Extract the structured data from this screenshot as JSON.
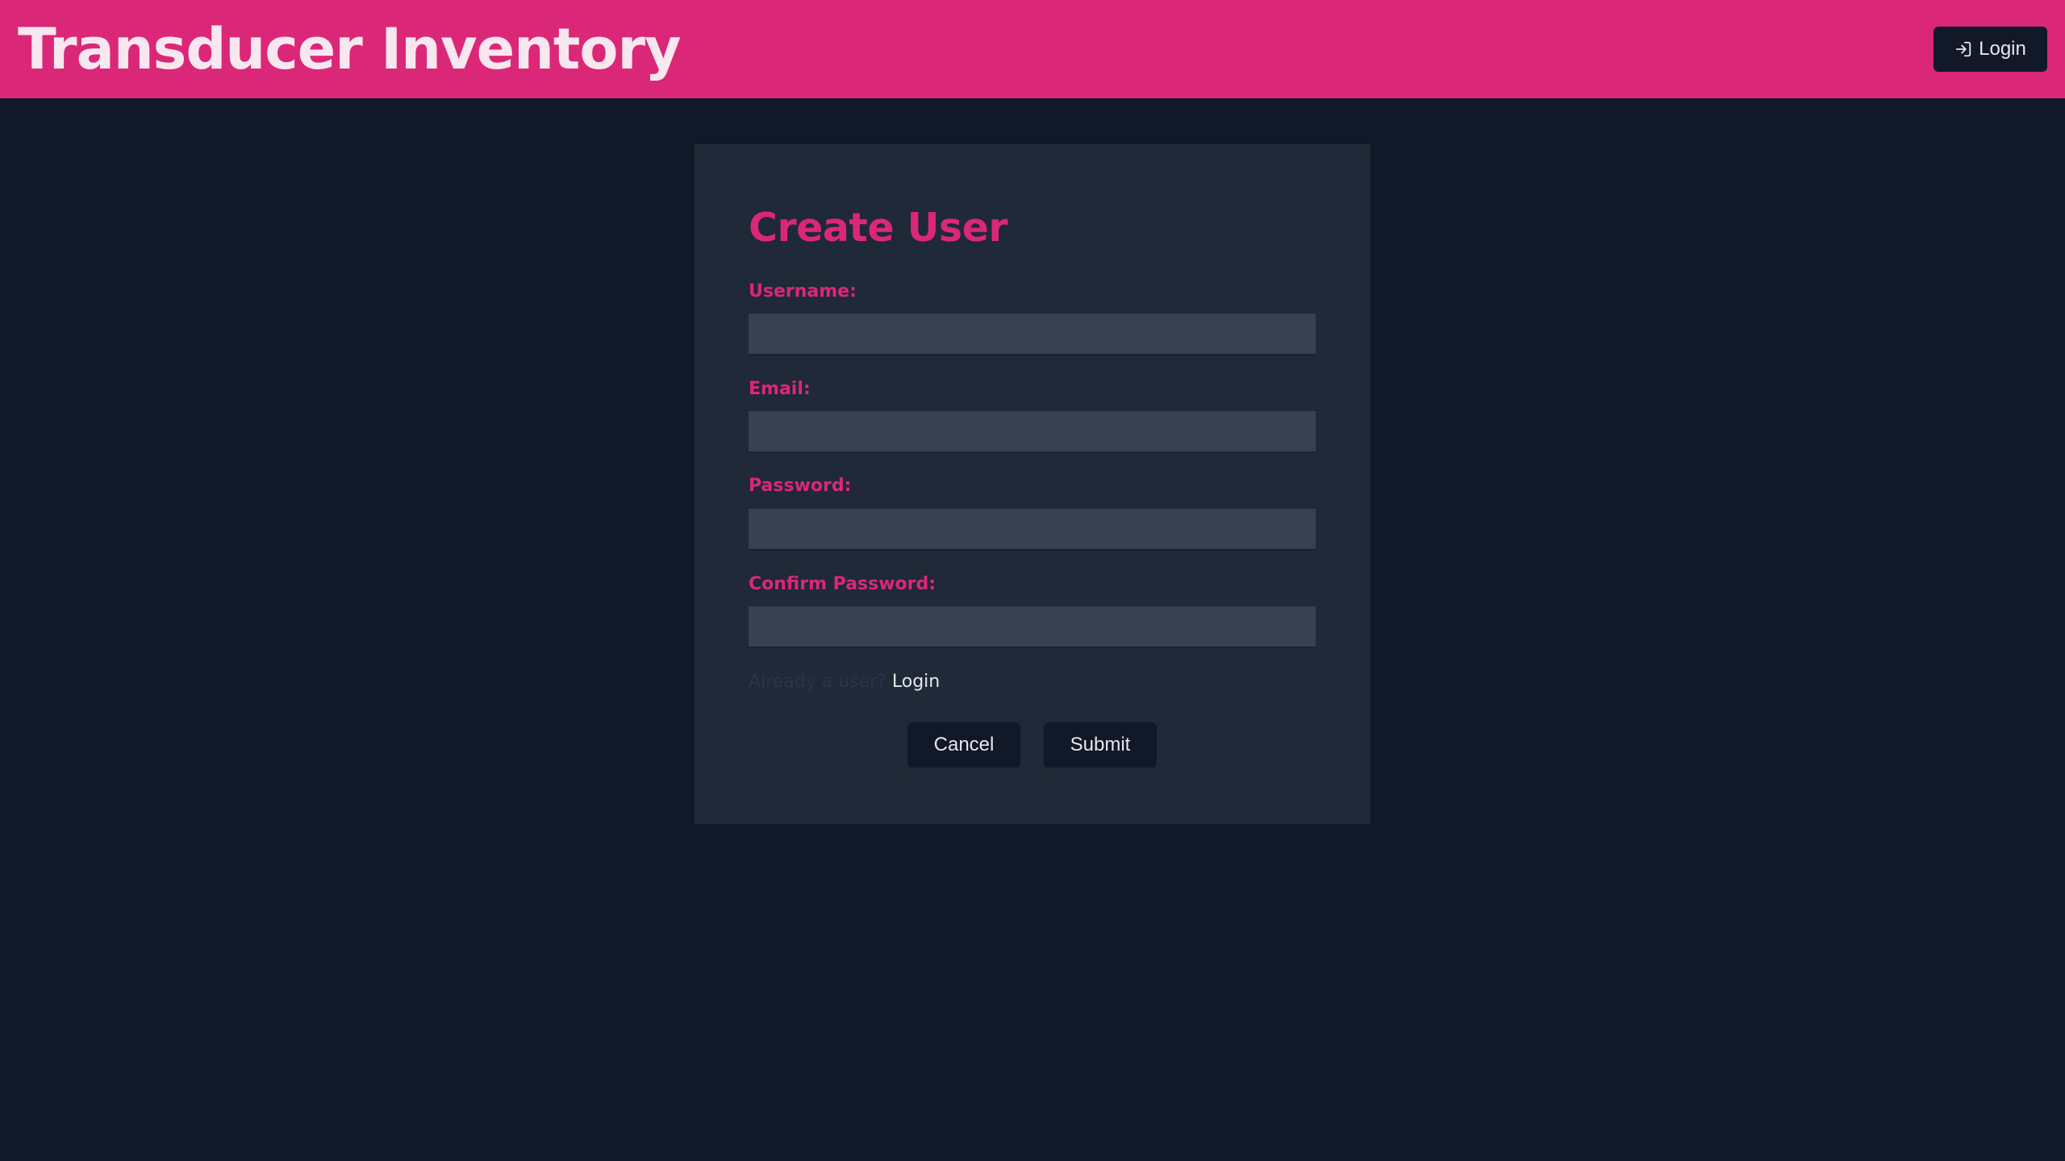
{
  "header": {
    "title": "Transducer Inventory",
    "login_label": "Login",
    "login_icon": "login-arrow-icon"
  },
  "form": {
    "title": "Create User",
    "fields": [
      {
        "label": "Username:",
        "value": "",
        "type": "text"
      },
      {
        "label": "Email:",
        "value": "",
        "type": "email"
      },
      {
        "label": "Password:",
        "value": "",
        "type": "password"
      },
      {
        "label": "Confirm Password:",
        "value": "",
        "type": "password"
      }
    ],
    "already_user_text": "Already a user?",
    "login_link": "Login",
    "cancel_label": "Cancel",
    "submit_label": "Submit"
  },
  "colors": {
    "accent": "#db2777",
    "background": "#111827",
    "card": "#1f2937",
    "input": "#374151"
  }
}
